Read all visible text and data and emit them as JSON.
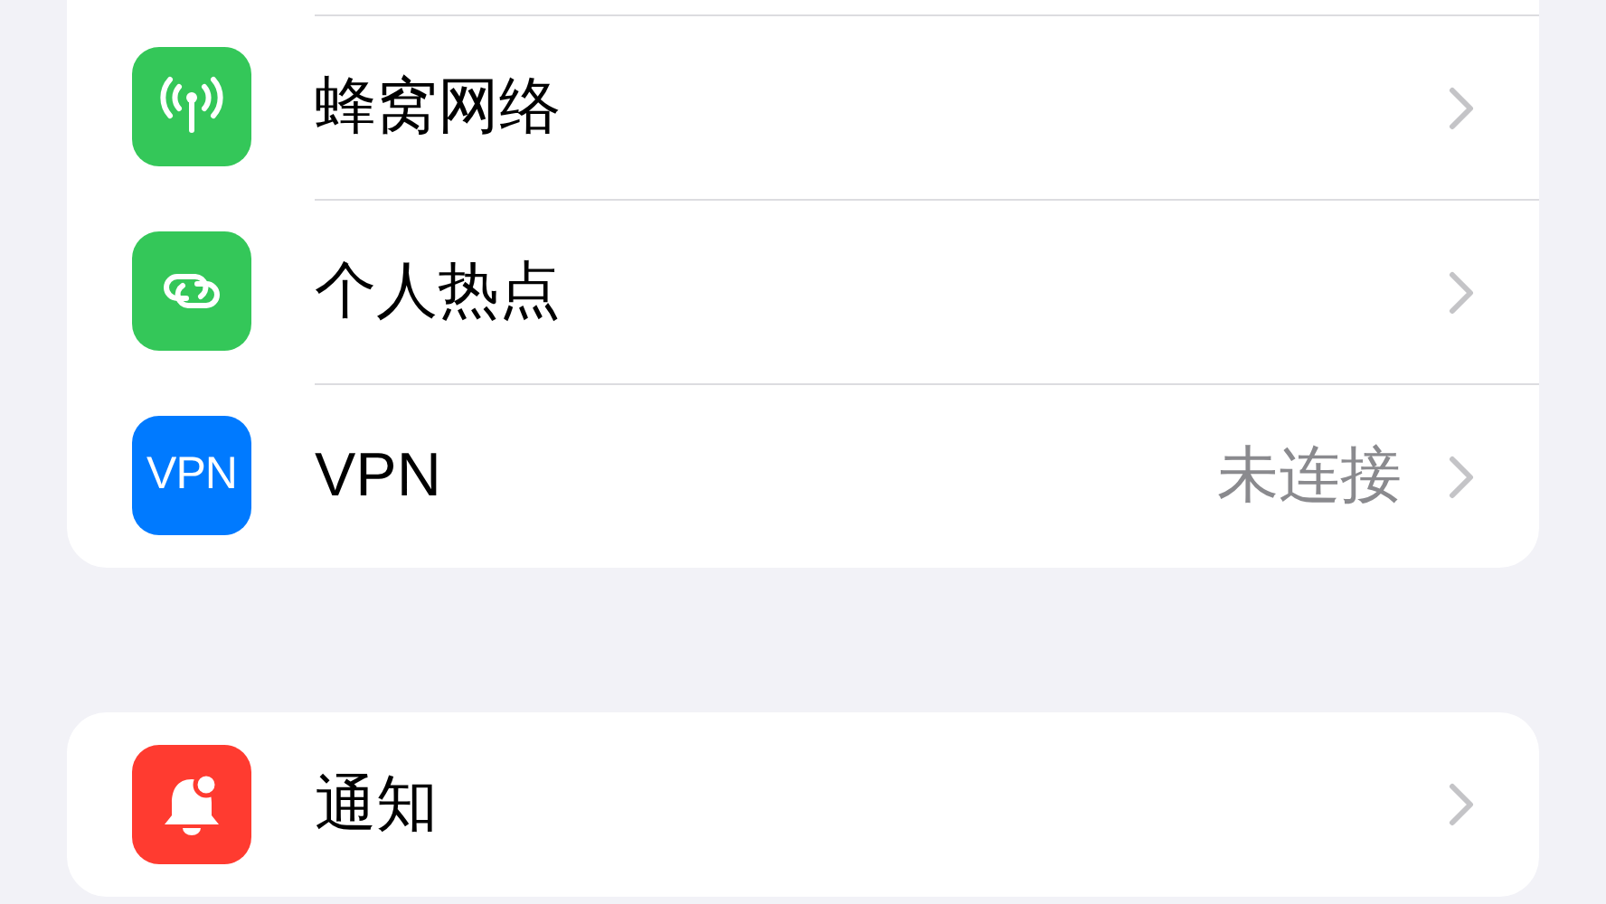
{
  "groups": [
    {
      "rows": [
        {
          "kind": "cellular",
          "label": "蜂窝网络"
        },
        {
          "kind": "hotspot",
          "label": "个人热点"
        },
        {
          "kind": "vpn",
          "label": "VPN",
          "icon_text": "VPN",
          "value": "未连接"
        }
      ]
    },
    {
      "rows": [
        {
          "kind": "notifications",
          "label": "通知"
        }
      ]
    }
  ]
}
